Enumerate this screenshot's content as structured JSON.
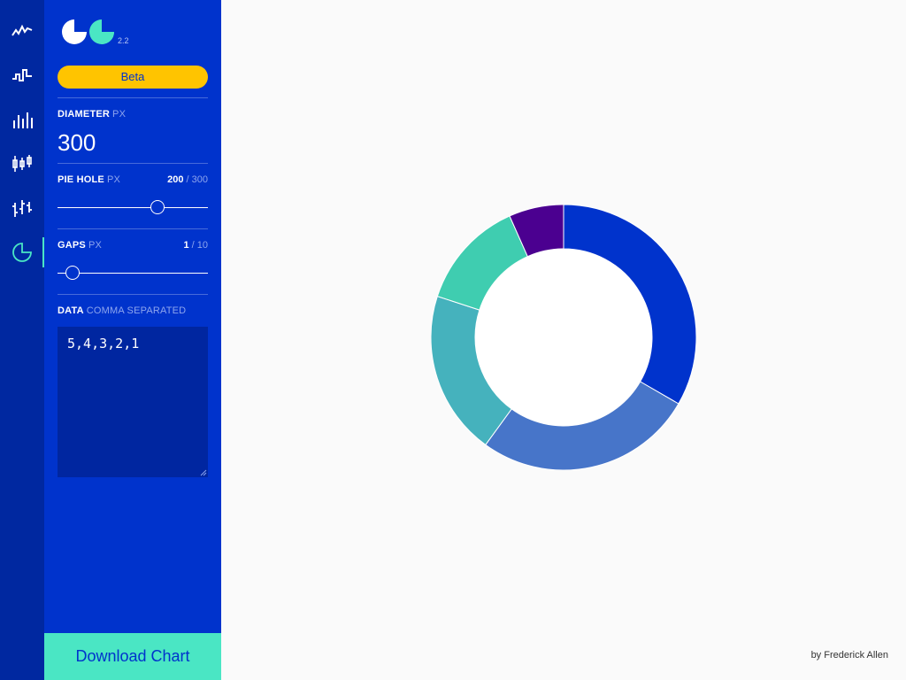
{
  "rail": {
    "items": [
      {
        "name": "line-chart-icon",
        "active": false
      },
      {
        "name": "step-chart-icon",
        "active": false
      },
      {
        "name": "bar-chart-icon",
        "active": false
      },
      {
        "name": "candlestick-chart-icon",
        "active": false
      },
      {
        "name": "ohlc-chart-icon",
        "active": false
      },
      {
        "name": "pie-chart-icon",
        "active": true
      }
    ],
    "active_color": "#4ae6c4"
  },
  "panel": {
    "version": "2.2",
    "beta_label": "Beta",
    "diameter": {
      "label": "DIAMETER",
      "unit": "PX",
      "value": "300"
    },
    "pie_hole": {
      "label": "PIE HOLE",
      "unit": "PX",
      "value": "200",
      "max": "/ 300",
      "fraction": 0.667
    },
    "gaps": {
      "label": "GAPS",
      "unit": "PX",
      "value": "1",
      "max": "/ 10",
      "fraction": 0.1
    },
    "data": {
      "label": "DATA",
      "hint": "COMMA SEPARATED",
      "value": "5,4,3,2,1"
    },
    "download_label": "Download Chart"
  },
  "credit": "by Frederick Allen",
  "colors": {
    "panel": "#0033cc",
    "rail": "#0028a0",
    "accent": "#4ae6c4",
    "beta": "#ffc400"
  },
  "chart_data": {
    "type": "pie",
    "values": [
      5,
      4,
      3,
      2,
      1
    ],
    "diameter": 300,
    "hole": 200,
    "gap": 1,
    "colors": [
      "#0033cc",
      "#4775c9",
      "#45b2bd",
      "#3fcdb0",
      "#4b0090"
    ]
  }
}
